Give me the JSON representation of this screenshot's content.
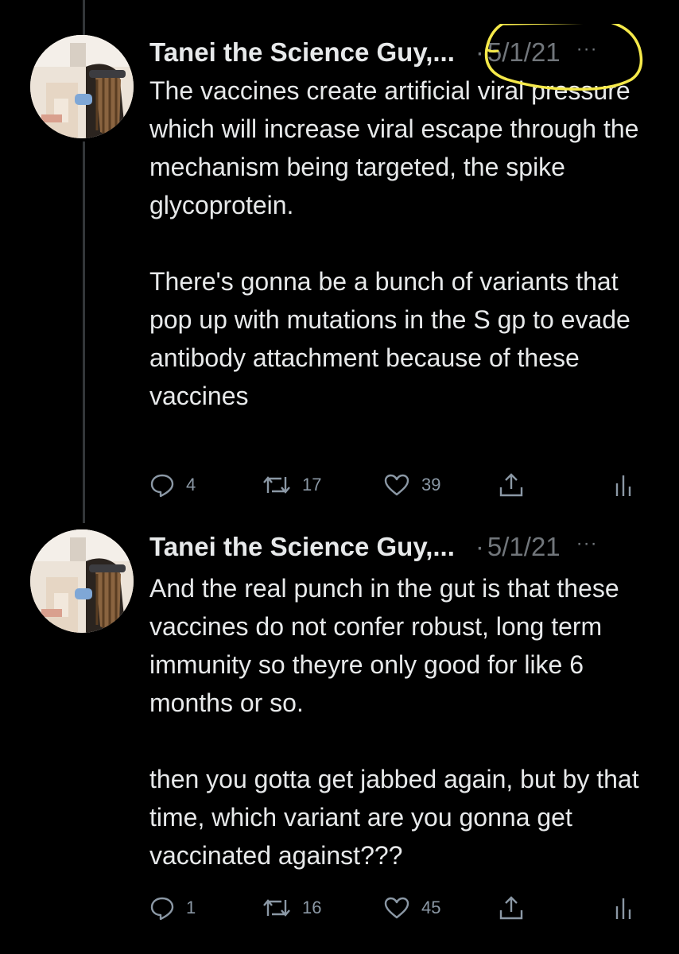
{
  "tweets": [
    {
      "author": "Tanei the Science Guy,...",
      "date": "5/1/21",
      "separator": "·",
      "more": "···",
      "paragraphs": [
        "The vaccines create artificial viral pressure which will increase viral escape through the mechanism being targeted, the spike glycoprotein.",
        "There's gonna be a bunch of variants that pop up with mutations in the S gp to evade antibody attachment because of these vaccines"
      ],
      "replies": "4",
      "retweets": "17",
      "likes": "39"
    },
    {
      "author": "Tanei the Science Guy,...",
      "date": "5/1/21",
      "separator": "·",
      "more": "···",
      "paragraphs": [
        "And the real punch in the gut is that these vaccines do not confer robust, long term immunity so theyre only good for like 6 months or so.",
        "then you gotta get jabbed again, but by that time, which variant are you gonna get vaccinated against???"
      ],
      "replies": "1",
      "retweets": "16",
      "likes": "45"
    }
  ],
  "icons": {
    "reply": "reply-icon",
    "retweet": "retweet-icon",
    "like": "heart-icon",
    "share": "share-icon",
    "analytics": "analytics-icon"
  },
  "colors": {
    "background": "#000000",
    "text": "#e7e9ea",
    "secondary": "#71767b",
    "highlight_annotation": "#f5e94a"
  }
}
